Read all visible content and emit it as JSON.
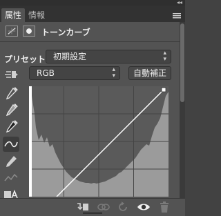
{
  "window": {
    "collapse_glyph": "◂◂"
  },
  "tabs": [
    {
      "label": "属性",
      "active": true
    },
    {
      "label": "情報",
      "active": false
    }
  ],
  "header": {
    "title": "トーンカーブ"
  },
  "preset": {
    "label": "プリセット：",
    "value": "初期設定"
  },
  "channel": {
    "value": "RGB"
  },
  "auto_button": {
    "label": "自動補正"
  },
  "tools": [
    "target-adjust-icon",
    "white-point-eyedropper-icon",
    "gray-point-eyedropper-icon",
    "black-point-eyedropper-icon",
    "curve-point-icon",
    "pencil-icon",
    "smooth-icon",
    "clipping-warning-icon"
  ],
  "bottom_icons": [
    "clip-to-layer-icon",
    "view-previous-icon",
    "reset-icon",
    "visibility-eye-icon",
    "trash-icon"
  ],
  "colors": {
    "panel": "#535353",
    "graph_bg": "#5a5a5a",
    "histogram": "#9b9b9b",
    "curve": "#ffffff"
  }
}
